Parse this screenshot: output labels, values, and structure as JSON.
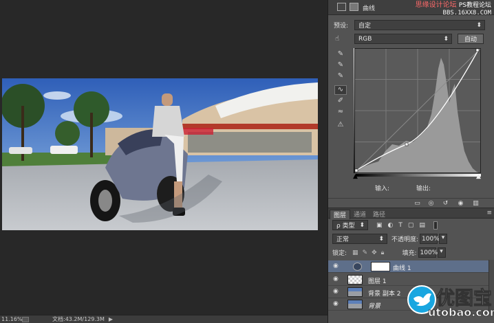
{
  "status": {
    "zoom": "11.16%",
    "doc_info": "文档:43.2M/129.3M"
  },
  "properties": {
    "title": "曲线",
    "preset_label": "预设:",
    "preset_value": "自定",
    "channel_value": "RGB",
    "auto_label": "自动",
    "input_label": "输入:",
    "output_label": "输出:"
  },
  "watermark_top": {
    "line1": "思缘设计论坛",
    "line1b": "PS教程论坛",
    "line2": "BBS.16XX8.COM"
  },
  "layers_panel": {
    "tabs": [
      "图层",
      "通道",
      "路径"
    ],
    "filter_value": "ρ 类型",
    "blend_mode": "正常",
    "opacity_label": "不透明度:",
    "opacity_value": "100%",
    "lock_label": "锁定:",
    "fill_label": "填充:",
    "fill_value": "100%",
    "layers": [
      {
        "name": "曲线 1",
        "selected": true
      },
      {
        "name": "图层 1",
        "selected": false
      },
      {
        "name": "背景 副本 2",
        "selected": false
      },
      {
        "name": "背景",
        "selected": false
      }
    ]
  },
  "logo": {
    "cn": "优图宝",
    "en": "utobao.com"
  }
}
